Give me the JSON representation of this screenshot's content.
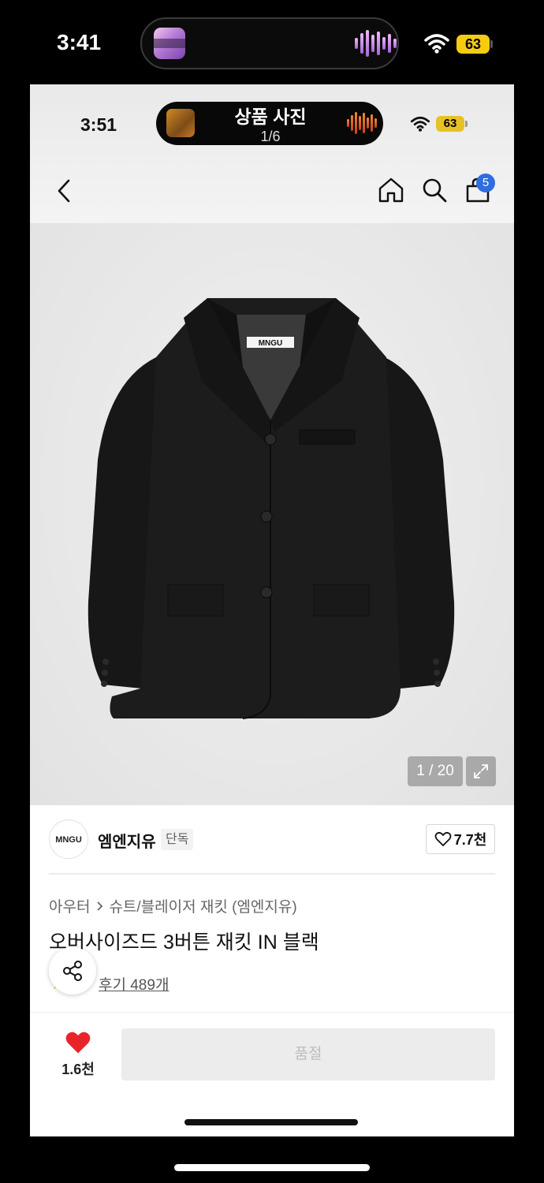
{
  "outer_status": {
    "time": "3:41",
    "battery": "63"
  },
  "viewer": {
    "title": "상품 사진",
    "page": "1/6"
  },
  "inner_status": {
    "time": "3:51",
    "battery": "63"
  },
  "header": {
    "cart_count": "5"
  },
  "product_image": {
    "counter": "1 / 20",
    "tag_text": "MNGU"
  },
  "brand": {
    "logo_text": "MNGU",
    "name": "엠엔지유",
    "badge": "단독",
    "likes": "7.7천"
  },
  "breadcrumb": {
    "category": "아우터",
    "sub": "슈트/블레이저 재킷 (엠엔지유)"
  },
  "product": {
    "name": "오버사이즈드 3버튼 재킷 IN 블랙",
    "reviews": "후기 489개"
  },
  "bottom_bar": {
    "like_count": "1.6천",
    "buy_label": "품절"
  },
  "colors": {
    "badge_blue": "#2f6de0",
    "heart_red": "#e8242b",
    "battery_yellow": "#f5cc11"
  }
}
